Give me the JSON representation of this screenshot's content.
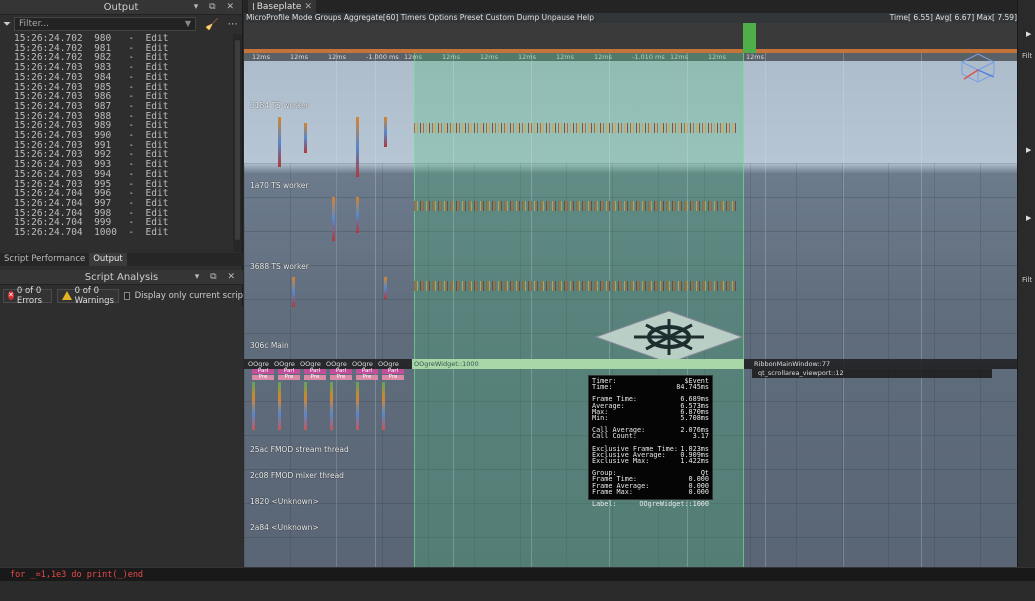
{
  "output_panel": {
    "title": "Output",
    "filter_placeholder": "Filter...",
    "log": [
      {
        "time": "15:26:24.702",
        "num": "980",
        "text": "Edit"
      },
      {
        "time": "15:26:24.702",
        "num": "981",
        "text": "Edit"
      },
      {
        "time": "15:26:24.702",
        "num": "982",
        "text": "Edit"
      },
      {
        "time": "15:26:24.703",
        "num": "983",
        "text": "Edit"
      },
      {
        "time": "15:26:24.703",
        "num": "984",
        "text": "Edit"
      },
      {
        "time": "15:26:24.703",
        "num": "985",
        "text": "Edit"
      },
      {
        "time": "15:26:24.703",
        "num": "986",
        "text": "Edit"
      },
      {
        "time": "15:26:24.703",
        "num": "987",
        "text": "Edit"
      },
      {
        "time": "15:26:24.703",
        "num": "988",
        "text": "Edit"
      },
      {
        "time": "15:26:24.703",
        "num": "989",
        "text": "Edit"
      },
      {
        "time": "15:26:24.703",
        "num": "990",
        "text": "Edit"
      },
      {
        "time": "15:26:24.703",
        "num": "991",
        "text": "Edit"
      },
      {
        "time": "15:26:24.703",
        "num": "992",
        "text": "Edit"
      },
      {
        "time": "15:26:24.703",
        "num": "993",
        "text": "Edit"
      },
      {
        "time": "15:26:24.703",
        "num": "994",
        "text": "Edit"
      },
      {
        "time": "15:26:24.703",
        "num": "995",
        "text": "Edit"
      },
      {
        "time": "15:26:24.704",
        "num": "996",
        "text": "Edit"
      },
      {
        "time": "15:26:24.704",
        "num": "997",
        "text": "Edit"
      },
      {
        "time": "15:26:24.704",
        "num": "998",
        "text": "Edit"
      },
      {
        "time": "15:26:24.704",
        "num": "999",
        "text": "Edit"
      },
      {
        "time": "15:26:24.704",
        "num": "1000",
        "text": "Edit"
      }
    ]
  },
  "bottom_tabs": [
    "Script Performance",
    "Output"
  ],
  "script_analysis": {
    "title": "Script Analysis",
    "errors_label": "0 of 0 Errors",
    "warnings_label": "0 of 0 Warnings",
    "display_only_label": "Display only current scrip"
  },
  "document_tab": {
    "label": "Baseplate"
  },
  "microprofile": {
    "menu": "MicroProfile   Mode Groups Aggregate[60] Timers Options Preset Custom Dump Unpause Help",
    "stats": "Time[  6.55] Avg[  6.67] Max[  7.59]",
    "ticks": [
      "12ms",
      "12ms",
      "12ms",
      "-1.000 ms",
      "12ms",
      "12ms",
      "12ms",
      "12ms",
      "12ms",
      "12ms",
      "-1.010 ms",
      "12ms",
      "12ms",
      "12ms"
    ],
    "threads": [
      {
        "label": "3184  TS worker"
      },
      {
        "label": "1a70  TS worker"
      },
      {
        "label": "3688  TS worker"
      },
      {
        "label": "306c  Main"
      },
      {
        "label": "25ac  FMOD stream thread"
      },
      {
        "label": "2c08  FMOD mixer thread"
      },
      {
        "label": "1820  <Unknown>"
      },
      {
        "label": "2a84  <Unknown>"
      }
    ],
    "ogre_labels": [
      "OOgre",
      "OOgre",
      "OOgre",
      "OOgre",
      "OOgre",
      "OOgre"
    ],
    "ogre_sub1": "Parl",
    "ogre_sub2": "Pre",
    "main_bar_green": "OOgreWidget::1000",
    "main_bar_right": "RibbonMainWindow::77",
    "main_bar_second": "qt_scrollarea_viewport::12"
  },
  "tooltip": {
    "rows": [
      [
        "Timer:",
        "$Event"
      ],
      [
        "Time:",
        "84.745ms"
      ],
      null,
      [
        "Frame Time:",
        "6.689ms"
      ],
      [
        "Average:",
        "6.573ms"
      ],
      [
        "Max:",
        "6.870ms"
      ],
      [
        "Min:",
        "5.708ms"
      ],
      null,
      [
        "Call Average:",
        "2.076ms"
      ],
      [
        "Call Count:",
        "3.17"
      ],
      null,
      [
        "Exclusive Frame Time:",
        "1.023ms"
      ],
      [
        "Exclusive Average:",
        "0.909ms"
      ],
      [
        "Exclusive Max:",
        "1.422ms"
      ],
      null,
      [
        "Group:",
        "Qt"
      ],
      [
        "Frame Time:",
        "0.000"
      ],
      [
        "Frame Average:",
        "0.000"
      ],
      [
        "Frame Max:",
        "0.000"
      ],
      null,
      [
        "Label:",
        "OOgreWidget::1000"
      ]
    ]
  },
  "right_edge": {
    "label_top": "Filt",
    "label_mid": "Filt"
  },
  "command_bar": {
    "text": "for _=1,1e3 do print(_)end"
  },
  "colors": {
    "accent_green": "#4fae4a",
    "error_red": "#d12f2f",
    "warning_yellow": "#e3b321",
    "command_red": "#e84a4a"
  }
}
